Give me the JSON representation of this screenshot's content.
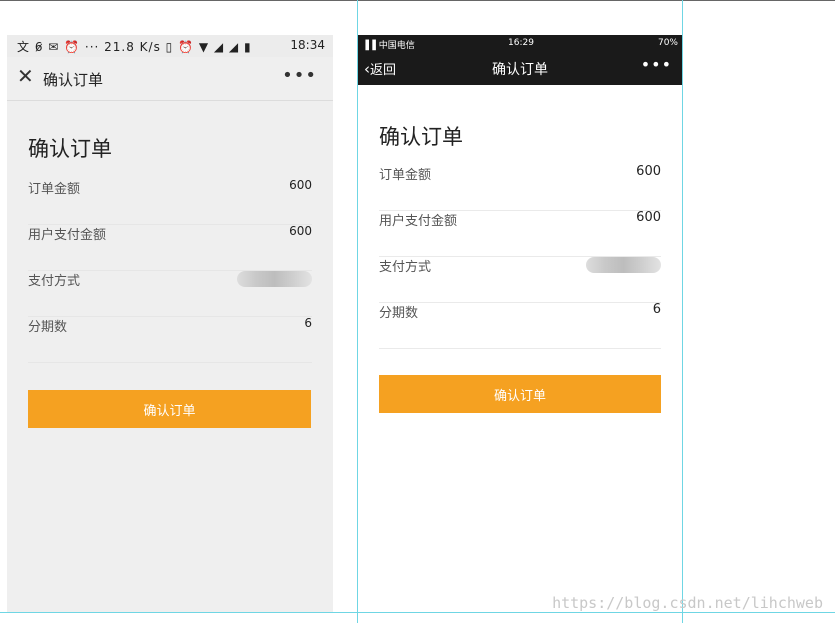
{
  "android": {
    "status": {
      "left": "文 6̷ ✉ ⏰ ··· 21.8 K/s ▯ ⏰ ▼ ◢ ◢ ▮",
      "time": "18:34"
    },
    "nav": {
      "close_glyph": "✕",
      "title": "确认订单",
      "more_glyph": "•••"
    },
    "page_title": "确认订单",
    "rows": [
      {
        "label": "订单金额",
        "value": "600"
      },
      {
        "label": "用户支付金额",
        "value": "600"
      },
      {
        "label": "支付方式",
        "value": ""
      },
      {
        "label": "分期数",
        "value": "6"
      }
    ],
    "button_label": "确认订单"
  },
  "ios": {
    "status": {
      "carrier": "▐▐ 中国电信",
      "time": "16:29",
      "battery": "70%"
    },
    "nav": {
      "back_label": "返回",
      "title": "确认订单",
      "more_glyph": "•••"
    },
    "page_title": "确认订单",
    "rows": [
      {
        "label": "订单金额",
        "value": "600"
      },
      {
        "label": "用户支付金额",
        "value": "600"
      },
      {
        "label": "支付方式",
        "value": ""
      },
      {
        "label": "分期数",
        "value": "6"
      }
    ],
    "button_label": "确认订单"
  },
  "colors": {
    "accent": "#f5a121",
    "ios_header": "#1a1a1a",
    "guide": "#6fd6e4"
  },
  "watermark": "https://blog.csdn.net/lihchweb"
}
